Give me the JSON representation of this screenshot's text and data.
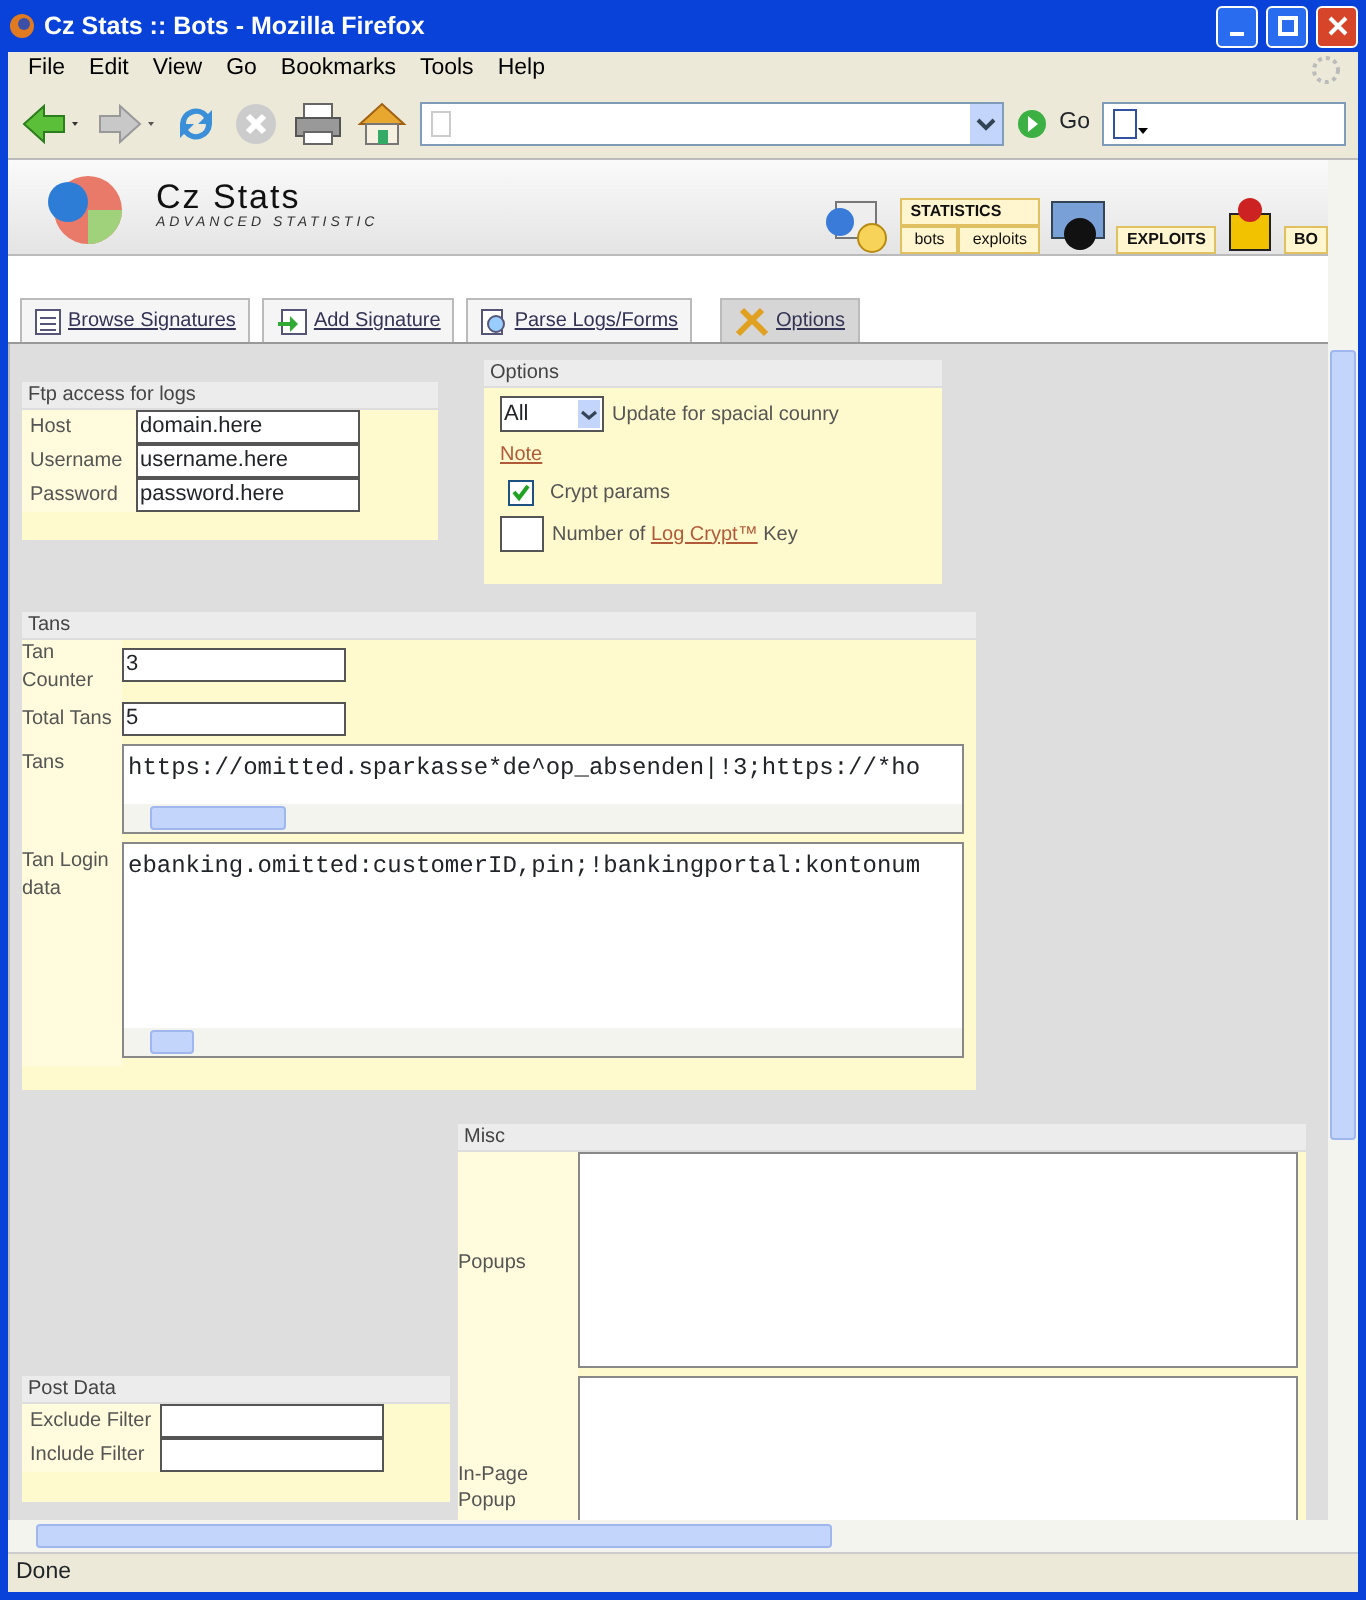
{
  "window": {
    "title": "Cz Stats :: Bots - Mozilla Firefox"
  },
  "menu": [
    "File",
    "Edit",
    "View",
    "Go",
    "Bookmarks",
    "Tools",
    "Help"
  ],
  "toolbar": {
    "go": "Go"
  },
  "site": {
    "logo": "Cz Stats",
    "tagline": "ADVANCED STATISTIC",
    "nav": [
      {
        "label": "STATISTICS",
        "subs": [
          "bots",
          "exploits"
        ]
      },
      {
        "label": "EXPLOITS"
      },
      {
        "label": "BO"
      }
    ]
  },
  "tabs": [
    {
      "label": "Browse Signatures",
      "selected": false
    },
    {
      "label": "Add Signature",
      "selected": false
    },
    {
      "label": "Parse Logs/Forms",
      "selected": false
    },
    {
      "label": "Options",
      "selected": true
    }
  ],
  "ftp": {
    "title": "Ftp access for logs",
    "fields": [
      {
        "label": "Host",
        "value": "domain.here"
      },
      {
        "label": "Username",
        "value": "username.here"
      },
      {
        "label": "Password",
        "value": "password.here"
      }
    ]
  },
  "options": {
    "title": "Options",
    "country": {
      "value": "All",
      "label": "Update for spacial counry"
    },
    "note": "Note",
    "crypt": {
      "label": "Crypt params",
      "checked": true
    },
    "key": {
      "before": "Number of",
      "link": "Log Crypt™",
      "after": "Key"
    }
  },
  "tans": {
    "title": "Tans",
    "fields": [
      {
        "kind": "input",
        "label": "Tan Counter",
        "value": "3"
      },
      {
        "kind": "input",
        "label": "Total Tans",
        "value": "5"
      },
      {
        "kind": "textarea",
        "label": "Tans",
        "value": "https://omitted.sparkasse*de^op_absenden|!3;https://*ho"
      },
      {
        "kind": "tallarea",
        "label": "Tan Login data",
        "value": "ebanking.omitted:customerID,pin;!bankingportal:kontonum"
      }
    ]
  },
  "post": {
    "title": "Post Data",
    "fields": [
      {
        "label": "Exclude Filter"
      },
      {
        "label": "Include Filter"
      }
    ]
  },
  "misc": {
    "title": "Misc",
    "fields": [
      {
        "label": "Popups"
      },
      {
        "label": "In-Page Popup"
      }
    ]
  },
  "status_bar": "Done"
}
